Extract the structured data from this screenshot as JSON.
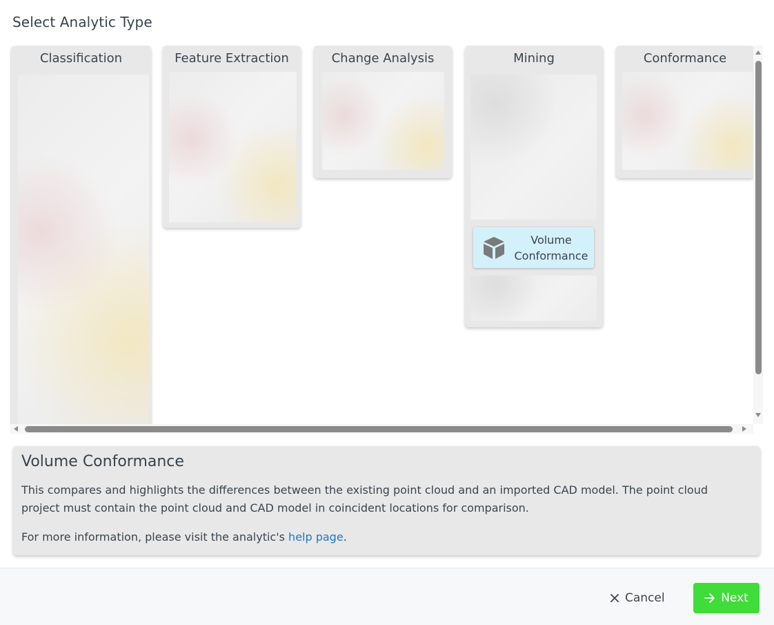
{
  "page_title": "Select Analytic Type",
  "columns": [
    {
      "title": "Classification"
    },
    {
      "title": "Feature Extraction"
    },
    {
      "title": "Change Analysis"
    },
    {
      "title": "Mining",
      "selected_tile": {
        "label": "Volume Conformance",
        "icon": "cube-icon"
      }
    },
    {
      "title": "Conformance"
    }
  ],
  "description": {
    "title": "Volume Conformance",
    "text": "This compares and highlights the differences between the existing point cloud and an imported CAD model. The point cloud project must contain the point cloud and CAD model in coincident locations for comparison.",
    "more_prefix": "For more information, please visit the analytic's ",
    "link_text": "help page",
    "more_suffix": "."
  },
  "footer": {
    "cancel_label": "Cancel",
    "cancel_icon": "close-icon",
    "next_label": "Next",
    "next_icon": "arrow-right-icon"
  },
  "colors": {
    "tile_selected": "#d3f1fb",
    "next_button": "#3fdc3a",
    "link": "#1f75c4"
  }
}
